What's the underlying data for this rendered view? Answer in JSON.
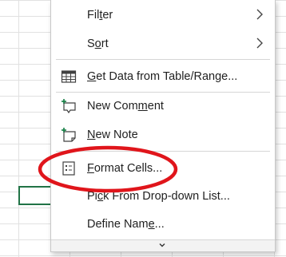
{
  "context_menu": {
    "items": [
      {
        "id": "filter",
        "label": "Filter",
        "mnemonic_index": 3,
        "submenu": true,
        "icon": null
      },
      {
        "id": "sort",
        "label": "Sort",
        "mnemonic_index": 1,
        "submenu": true,
        "icon": null
      },
      {
        "id": "get-data",
        "label": "Get Data from Table/Range...",
        "mnemonic_index": 0,
        "submenu": false,
        "icon": "table-icon"
      },
      {
        "id": "new-comment",
        "label": "New Comment",
        "mnemonic_index": 7,
        "submenu": false,
        "icon": "new-comment-icon"
      },
      {
        "id": "new-note",
        "label": "New Note",
        "mnemonic_index": 0,
        "submenu": false,
        "icon": "new-note-icon"
      },
      {
        "id": "format-cells",
        "label": "Format Cells...",
        "mnemonic_index": 0,
        "submenu": false,
        "icon": "format-cells-icon"
      },
      {
        "id": "pick-list",
        "label": "Pick From Drop-down List...",
        "mnemonic_index": 2,
        "submenu": false,
        "icon": null
      },
      {
        "id": "define-name",
        "label": "Define Name...",
        "mnemonic_index": 10,
        "submenu": false,
        "icon": null
      }
    ],
    "scroll_icon": "chevron-down-icon"
  },
  "annotation": {
    "shape": "ellipse",
    "color": "#e0151b",
    "target": "format-cells"
  },
  "colors": {
    "selection_border": "#217346",
    "gridline": "#e1e1e1",
    "accent_green": "#107c41"
  }
}
